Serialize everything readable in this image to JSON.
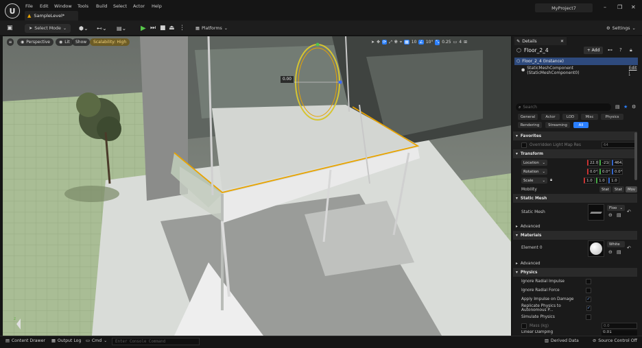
{
  "app": {
    "project": "MyProject7",
    "level_tab": "SampleLevel*"
  },
  "menu": [
    "File",
    "Edit",
    "Window",
    "Tools",
    "Build",
    "Select",
    "Actor",
    "Help"
  ],
  "toolbar": {
    "select_mode": "Select Mode",
    "platforms": "Platforms",
    "settings": "Settings"
  },
  "viewport": {
    "perspective": "Perspective",
    "lit": "Lit",
    "show": "Show",
    "scalability": "Scalability: High",
    "rotation_readout": "0.00",
    "grid_snap": "10",
    "angle_snap": "10°",
    "scale_snap": "0.25",
    "camera_speed": "4"
  },
  "details": {
    "tab": "Details",
    "title": "Floor_2_4",
    "add_label": "+ Add",
    "instance_row": "Floor_2_4 (Instance)",
    "component_row": "StaticMeshComponent (StaticMeshComponent0)",
    "edit_label": "Edit i",
    "search_placeholder": "Search",
    "categories": [
      "General",
      "Actor",
      "LOD",
      "Misc",
      "Physics",
      "Rendering",
      "Streaming",
      "All"
    ],
    "favorites": {
      "header": "Favorites",
      "override_label": "Overridden Light Map Res",
      "override_value": "64"
    },
    "transform": {
      "header": "Transform",
      "location": {
        "label": "Location",
        "values": [
          "22.0",
          "-21(",
          "464."
        ]
      },
      "rotation": {
        "label": "Rotation",
        "values": [
          "0.0°",
          "0.0°",
          "0.0°"
        ]
      },
      "scale": {
        "label": "Scale",
        "values": [
          "1.0",
          "1.0",
          "1.0"
        ]
      },
      "mobility": {
        "label": "Mobility",
        "options": [
          "Stat",
          "Stat",
          "Mov"
        ]
      }
    },
    "static_mesh": {
      "header": "Static Mesh",
      "label": "Static Mesh",
      "value": "Floo"
    },
    "advanced1": "Advanced",
    "materials": {
      "header": "Materials",
      "element": "Element 0",
      "value": "White"
    },
    "advanced2": "Advanced",
    "physics": {
      "header": "Physics",
      "rows": [
        {
          "label": "Ignore Radial Impulse",
          "checked": false
        },
        {
          "label": "Ignore Radial Force",
          "checked": false
        },
        {
          "label": "Apply Impulse on Damage",
          "checked": true
        },
        {
          "label": "Replicate Physics to Autonomous P...",
          "checked": true
        },
        {
          "label": "Simulate Physics",
          "checked": false
        }
      ],
      "mass_label": "Mass (kg)",
      "mass_value": "0.0",
      "linear_label": "Linear Damping",
      "linear_value": "0.01"
    }
  },
  "status": {
    "content_drawer": "Content Drawer",
    "output_log": "Output Log",
    "cmd": "Cmd",
    "console_placeholder": "Enter Console Command",
    "derived_data": "Derived Data",
    "source_control": "Source Control Off"
  },
  "colors": {
    "accent": "#2a7fff",
    "selection": "#e8a300",
    "panel": "#1a1a1a"
  }
}
